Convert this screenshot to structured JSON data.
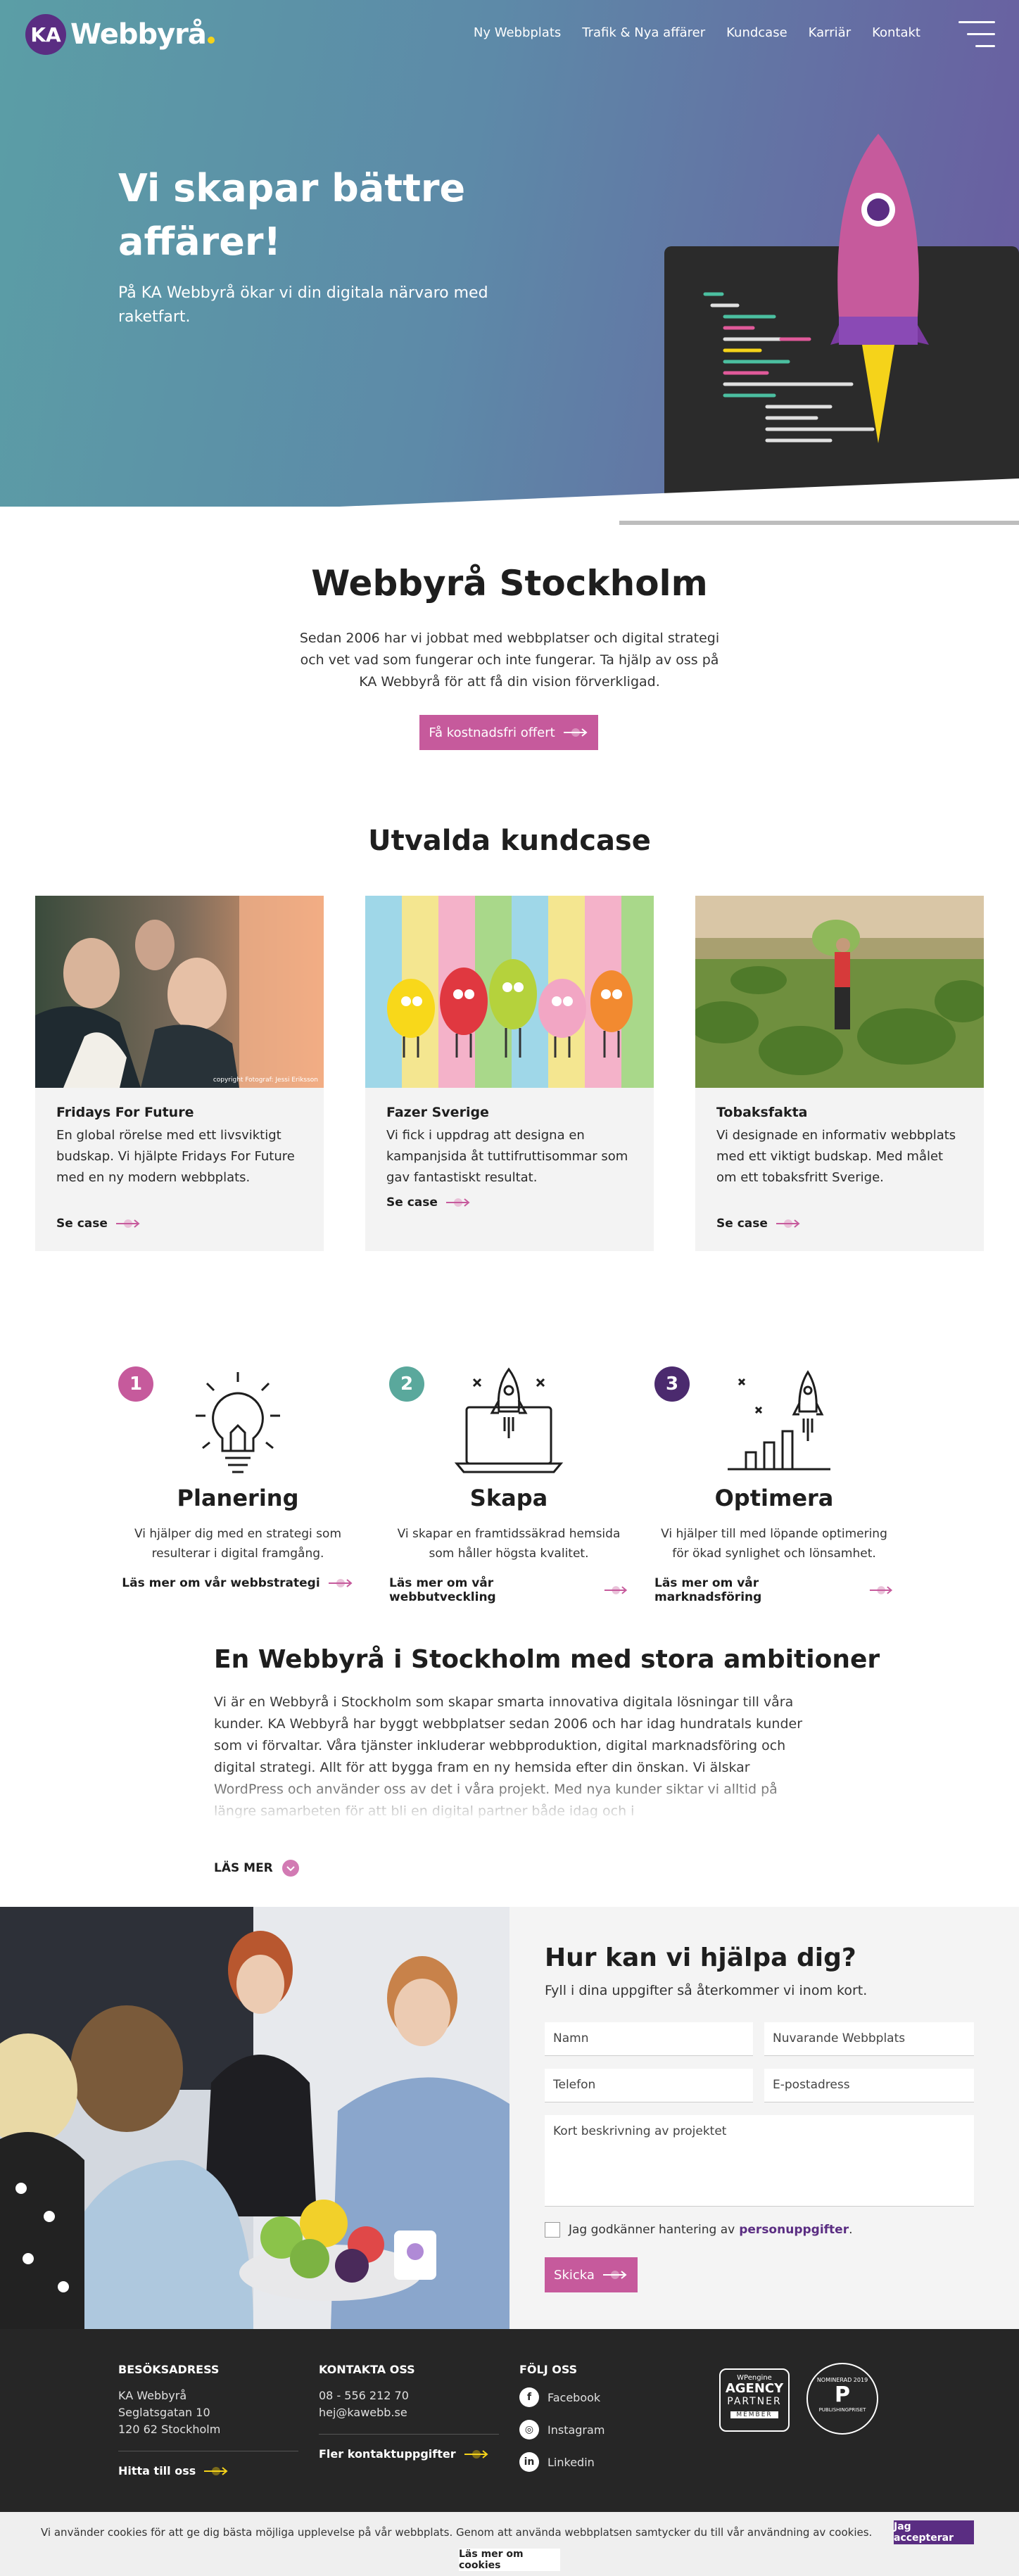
{
  "header": {
    "logo_badge": "KA",
    "logo_text": "Webbyrå",
    "nav": [
      "Ny Webbplats",
      "Trafik & Nya affärer",
      "Kundcase",
      "Karriär",
      "Kontakt"
    ]
  },
  "hero": {
    "title": "Vi skapar bättre affärer!",
    "subtitle": "På KA Webbyrå ökar vi din digitala närvaro med raketfart."
  },
  "intro": {
    "title": "Webbyrå Stockholm",
    "text": "Sedan 2006 har vi jobbat med webbplatser och digital strategi och vet vad som fungerar och inte fungerar. Ta hjälp av oss på KA Webbyrå för att få din vision förverkligad.",
    "button": "Få kostnadsfri offert"
  },
  "cases": {
    "title": "Utvalda kundcase",
    "items": [
      {
        "title": "Fridays For Future",
        "text": "En global rörelse med ett livsviktigt budskap. Vi hjälpte Fridays For Future med en ny modern webbplats.",
        "link": "Se case",
        "photo_credit": "copyright Fotograf: Jessi Eriksson"
      },
      {
        "title": "Fazer Sverige",
        "text": "Vi fick i uppdrag att designa en kampanjsida åt tuttifruttisommar som gav fantastiskt resultat.",
        "link": "Se case"
      },
      {
        "title": "Tobaksfakta",
        "text": "Vi designade en informativ webbplats med ett viktigt budskap. Med målet om ett tobaksfritt Sverige.",
        "link": "Se case"
      }
    ]
  },
  "steps": [
    {
      "num": "1",
      "title": "Planering",
      "text": "Vi hjälper dig med en strategi som resulterar i digital framgång.",
      "link": "Läs mer om vår webbstrategi",
      "color": "#c65a9c",
      "icon": "lightbulb-icon"
    },
    {
      "num": "2",
      "title": "Skapa",
      "text": "Vi skapar en framtidssäkrad hemsida som håller högsta kvalitet.",
      "link": "Läs mer om vår webbutveckling",
      "color": "#5aa89c",
      "icon": "laptop-rocket-icon"
    },
    {
      "num": "3",
      "title": "Optimera",
      "text": "Vi hjälper till med löpande optimering för ökad synlighet och lönsamhet.",
      "link": "Läs mer om vår marknadsföring",
      "color": "#4b2a6e",
      "icon": "growth-chart-icon"
    }
  ],
  "ambition": {
    "title": "En Webbyrå i Stockholm med stora ambitioner",
    "text": "Vi är en Webbyrå i Stockholm som skapar smarta innovativa digitala lösningar till våra kunder. KA Webbyrå har byggt webbplatser sedan 2006 och har idag hundratals kunder som vi förvaltar. Våra tjänster inkluderar webbproduktion, digital marknadsföring och digital strategi. Allt för att bygga fram en ny hemsida efter din önskan. Vi älskar WordPress och använder oss av det i våra projekt. Med nya kunder siktar vi alltid på längre samarbeten för att bli en digital partner både idag och i",
    "read_more": "LÄS MER"
  },
  "contact": {
    "title": "Hur kan vi hjälpa dig?",
    "subtitle": "Fyll i dina uppgifter så återkommer vi inom kort.",
    "fields": {
      "name": "Namn",
      "website": "Nuvarande Webbplats",
      "phone": "Telefon",
      "email": "E-postadress",
      "description": "Kort beskrivning av projektet"
    },
    "consent_prefix": "Jag godkänner hantering av",
    "consent_link": "personuppgifter",
    "consent_suffix": ".",
    "submit": "Skicka"
  },
  "footer": {
    "visit": {
      "head": "BESÖKSADRESS",
      "lines": [
        "KA Webbyrå",
        "Seglatsgatan 10",
        "120 62 Stockholm"
      ],
      "link": "Hitta till oss"
    },
    "contact": {
      "head": "KONTAKTA OSS",
      "phone": "08 - 556 212 70",
      "email": "hej@kawebb.se",
      "link": "Fler kontaktuppgifter"
    },
    "follow": {
      "head": "FÖLJ OSS",
      "items": [
        "Facebook",
        "Instagram",
        "Linkedin"
      ]
    },
    "badges": {
      "wpengine": {
        "top": "WPengine",
        "mid": "AGENCY",
        "mid2": "PARTNER",
        "bottom": "MEMBER"
      },
      "award": {
        "line1": "NOMINERAD 2019",
        "line2": "PUBLISHINGPRISET"
      }
    }
  },
  "cookie": {
    "text": "Vi använder cookies för att ge dig bästa möjliga upplevelse på vår webbplats. Genom att använda webbplatsen samtycker du till vår användning av cookies.",
    "accept": "Jag accepterar",
    "more": "Läs mer om cookies"
  },
  "colors": {
    "brand_purple": "#5a2d82",
    "accent_pink": "#c65a9c",
    "accent_yellow": "#f5d31a",
    "teal": "#5aa89c"
  }
}
